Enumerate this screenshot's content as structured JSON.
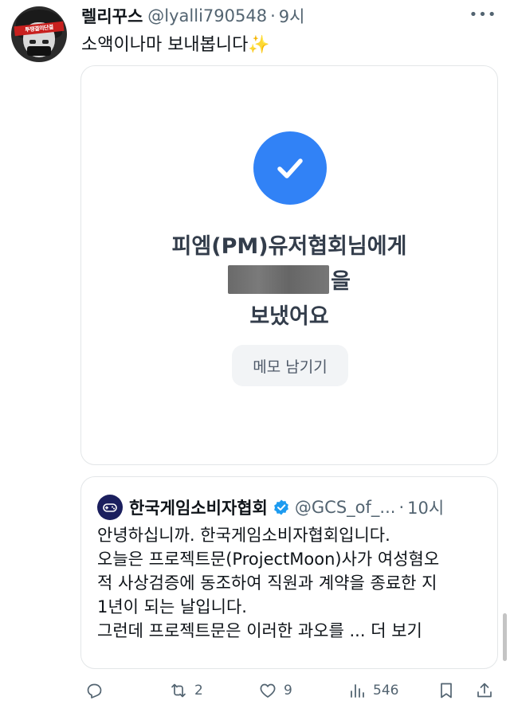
{
  "tweet": {
    "author_name": "렐리꾸스",
    "handle": "@lyalli790548",
    "separator": "·",
    "time": "9시",
    "text": "소액이나마 보내봅니다",
    "emoji": "✨",
    "avatar_band_text": "투쟁결의단결",
    "more_icon": "•••"
  },
  "transfer_card": {
    "line1": "피엠(PM)유저협회님에게",
    "line2_suffix": "을",
    "line3": "보냈어요",
    "memo_button": "메모 남기기",
    "accent_color": "#3182f6"
  },
  "quote": {
    "name": "한국게임소비자협회",
    "handle": "@GCS_of_...",
    "separator": "·",
    "time": "10시",
    "lines": [
      "안녕하십니까. 한국게임소비자협회입니다.",
      "오늘은 프로젝트문(ProjectMoon)사가 여성혐오",
      "적 사상검증에 동조하여 직원과 계약을 종료한 지",
      "1년이 되는 날입니다.",
      "그런데 프로젝트문은 이러한 과오를 ... 더 보기"
    ]
  },
  "actions": {
    "reply_count": "",
    "retweet_count": "2",
    "like_count": "9",
    "views_count": "546"
  }
}
